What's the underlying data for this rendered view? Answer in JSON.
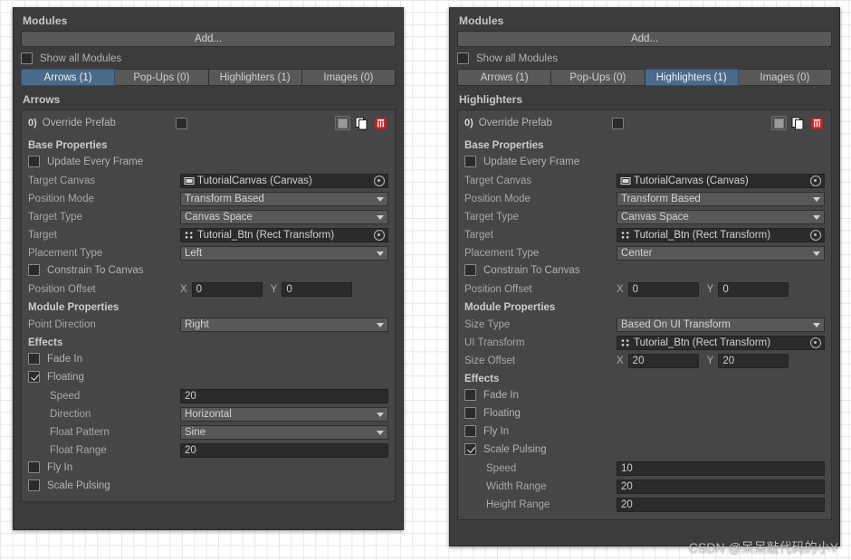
{
  "background": {
    "grid_color": "#e8e8e8",
    "page_color": "#ffffff"
  },
  "theme": {
    "panel_bg": "#3c3c3c",
    "module_bg": "#464646",
    "field_dark": "#2b2b2b",
    "control_gray": "#585858",
    "selected_tab_blue": "#4a6b8a",
    "label_text": "#a9a9a9",
    "delete_red": "#e21a22"
  },
  "watermark": "CSDN @呆呆敲代码的小Y",
  "panels": [
    {
      "id": "left",
      "title": "Modules",
      "add_label": "Add...",
      "show_all_label": "Show all Modules",
      "show_all_checked": false,
      "tabs": [
        {
          "label": "Arrows (1)",
          "selected": true
        },
        {
          "label": "Pop-Ups (0)",
          "selected": false
        },
        {
          "label": "Highlighters (1)",
          "selected": false
        },
        {
          "label": "Images (0)",
          "selected": false
        }
      ],
      "section_title": "Arrows",
      "module": {
        "index_label": "0)",
        "override_label": "Override Prefab",
        "override_checked": false,
        "icons": [
          "prefab-square-icon",
          "duplicate-icon",
          "delete-icon"
        ],
        "groups": [
          {
            "heading": "Base Properties",
            "rows": [
              {
                "label": "Update Every Frame",
                "type": "checkbox",
                "checked": false
              },
              {
                "label": "Target Canvas",
                "type": "object",
                "value": "TutorialCanvas (Canvas)",
                "icon": "canvas-icon"
              },
              {
                "label": "Position Mode",
                "type": "dropdown",
                "value": "Transform Based"
              },
              {
                "label": "Target Type",
                "type": "dropdown",
                "value": "Canvas Space"
              },
              {
                "label": "Target",
                "type": "object",
                "value": "Tutorial_Btn (Rect Transform)",
                "icon": "recttransform-icon"
              },
              {
                "label": "Placement Type",
                "type": "dropdown",
                "value": "Left"
              },
              {
                "label": "Constrain To Canvas",
                "type": "checkbox",
                "checked": false
              },
              {
                "label": "Position Offset",
                "type": "xy",
                "x_label": "X",
                "x_value": "0",
                "y_label": "Y",
                "y_value": "0"
              }
            ]
          },
          {
            "heading": "Module Properties",
            "rows": [
              {
                "label": "Point Direction",
                "type": "dropdown",
                "value": "Right"
              }
            ]
          },
          {
            "heading": "Effects",
            "rows": [
              {
                "label": "Fade In",
                "type": "checkbox",
                "checked": false
              },
              {
                "label": "Floating",
                "type": "checkbox",
                "checked": true
              },
              {
                "label": "Speed",
                "type": "text",
                "value": "20",
                "indent": true
              },
              {
                "label": "Direction",
                "type": "dropdown",
                "value": "Horizontal",
                "indent": true
              },
              {
                "label": "Float Pattern",
                "type": "dropdown",
                "value": "Sine",
                "indent": true
              },
              {
                "label": "Float Range",
                "type": "text",
                "value": "20",
                "indent": true
              },
              {
                "label": "Fly In",
                "type": "checkbox",
                "checked": false
              },
              {
                "label": "Scale Pulsing",
                "type": "checkbox",
                "checked": false
              }
            ]
          }
        ]
      }
    },
    {
      "id": "right",
      "title": "Modules",
      "add_label": "Add...",
      "show_all_label": "Show all Modules",
      "show_all_checked": false,
      "tabs": [
        {
          "label": "Arrows (1)",
          "selected": false
        },
        {
          "label": "Pop-Ups (0)",
          "selected": false
        },
        {
          "label": "Highlighters (1)",
          "selected": true
        },
        {
          "label": "Images (0)",
          "selected": false
        }
      ],
      "section_title": "Highlighters",
      "module": {
        "index_label": "0)",
        "override_label": "Override Prefab",
        "override_checked": false,
        "icons": [
          "prefab-square-icon",
          "duplicate-icon",
          "delete-icon"
        ],
        "groups": [
          {
            "heading": "Base Properties",
            "rows": [
              {
                "label": "Update Every Frame",
                "type": "checkbox",
                "checked": false
              },
              {
                "label": "Target Canvas",
                "type": "object",
                "value": "TutorialCanvas (Canvas)",
                "icon": "canvas-icon"
              },
              {
                "label": "Position Mode",
                "type": "dropdown",
                "value": "Transform Based"
              },
              {
                "label": "Target Type",
                "type": "dropdown",
                "value": "Canvas Space"
              },
              {
                "label": "Target",
                "type": "object",
                "value": "Tutorial_Btn (Rect Transform)",
                "icon": "recttransform-icon"
              },
              {
                "label": "Placement Type",
                "type": "dropdown",
                "value": "Center"
              },
              {
                "label": "Constrain To Canvas",
                "type": "checkbox",
                "checked": false
              },
              {
                "label": "Position Offset",
                "type": "xy",
                "x_label": "X",
                "x_value": "0",
                "y_label": "Y",
                "y_value": "0"
              }
            ]
          },
          {
            "heading": "Module Properties",
            "rows": [
              {
                "label": "Size Type",
                "type": "dropdown",
                "value": "Based On UI Transform"
              },
              {
                "label": "UI Transform",
                "type": "object",
                "value": "Tutorial_Btn (Rect Transform)",
                "icon": "recttransform-icon"
              },
              {
                "label": "Size Offset",
                "type": "xy",
                "x_label": "X",
                "x_value": "20",
                "y_label": "Y",
                "y_value": "20"
              }
            ]
          },
          {
            "heading": "Effects",
            "rows": [
              {
                "label": "Fade In",
                "type": "checkbox",
                "checked": false
              },
              {
                "label": "Floating",
                "type": "checkbox",
                "checked": false
              },
              {
                "label": "Fly In",
                "type": "checkbox",
                "checked": false
              },
              {
                "label": "Scale Pulsing",
                "type": "checkbox",
                "checked": true
              },
              {
                "label": "Speed",
                "type": "text",
                "value": "10",
                "indent": true
              },
              {
                "label": "Width Range",
                "type": "text",
                "value": "20",
                "indent": true
              },
              {
                "label": "Height Range",
                "type": "text",
                "value": "20",
                "indent": true
              }
            ]
          }
        ]
      }
    }
  ]
}
